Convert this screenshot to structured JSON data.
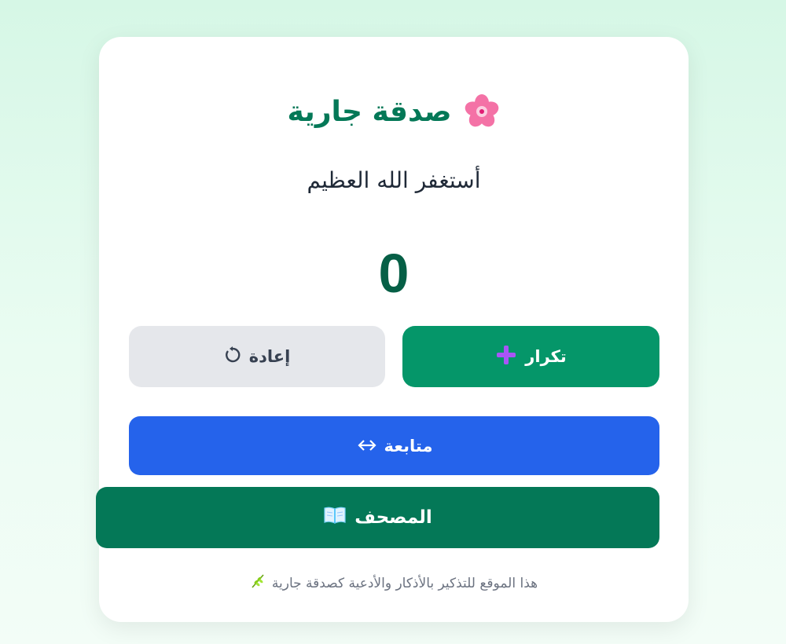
{
  "header": {
    "title": "صدقة جارية",
    "title_icon": "cherry-blossom-icon"
  },
  "dhikr": {
    "text": "أستغفر الله العظيم"
  },
  "counter": {
    "value": "0"
  },
  "buttons": {
    "repeat_label": "تكرار",
    "repeat_icon": "plus-icon",
    "reset_label": "إعادة",
    "reset_icon": "refresh-icon",
    "continue_label": "متابعة",
    "continue_icon": "arrow-icon",
    "mushaf_label": "المصحف",
    "mushaf_icon": "book-icon"
  },
  "footer": {
    "text": "هذا الموقع للتذكير بالأذكار والأدعية كصدقة جارية",
    "icon": "herb-icon"
  },
  "colors": {
    "accent_green": "#059669",
    "dark_green": "#047857",
    "blue": "#2563eb",
    "gray": "#e5e7eb"
  }
}
